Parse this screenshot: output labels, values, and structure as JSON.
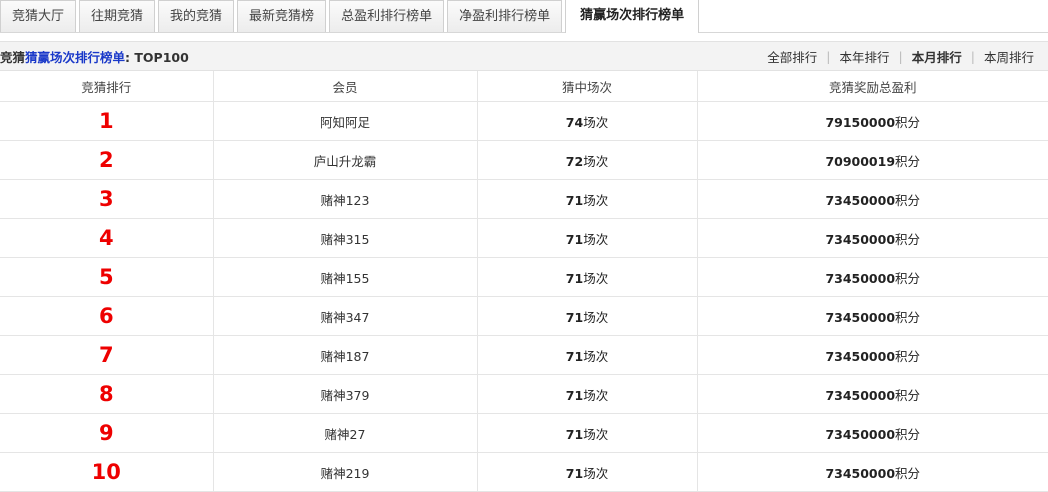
{
  "tabs": [
    {
      "label": "竞猜大厅",
      "active": false
    },
    {
      "label": "往期竞猜",
      "active": false
    },
    {
      "label": "我的竞猜",
      "active": false
    },
    {
      "label": "最新竞猜榜",
      "active": false
    },
    {
      "label": "总盈利排行榜单",
      "active": false
    },
    {
      "label": "净盈利排行榜单",
      "active": false
    },
    {
      "label": "猜赢场次排行榜单",
      "active": true
    }
  ],
  "header": {
    "prefix": "竞猜",
    "highlight": "猜赢场次排行榜单",
    "suffix": ": TOP100",
    "filters": [
      {
        "label": "全部排行",
        "current": false
      },
      {
        "label": "本年排行",
        "current": false
      },
      {
        "label": "本月排行",
        "current": true
      },
      {
        "label": "本周排行",
        "current": false
      }
    ]
  },
  "table": {
    "columns": [
      "竞猜排行",
      "会员",
      "猜中场次",
      "竞猜奖励总盈利"
    ],
    "rows": [
      {
        "rank": "1",
        "member": "阿知阿足",
        "count": "74",
        "count_unit": "场次",
        "score": "79150000",
        "score_unit": "积分"
      },
      {
        "rank": "2",
        "member": "庐山升龙霸",
        "count": "72",
        "count_unit": "场次",
        "score": "70900019",
        "score_unit": "积分"
      },
      {
        "rank": "3",
        "member": "赌神123",
        "count": "71",
        "count_unit": "场次",
        "score": "73450000",
        "score_unit": "积分"
      },
      {
        "rank": "4",
        "member": "赌神315",
        "count": "71",
        "count_unit": "场次",
        "score": "73450000",
        "score_unit": "积分"
      },
      {
        "rank": "5",
        "member": "赌神155",
        "count": "71",
        "count_unit": "场次",
        "score": "73450000",
        "score_unit": "积分"
      },
      {
        "rank": "6",
        "member": "赌神347",
        "count": "71",
        "count_unit": "场次",
        "score": "73450000",
        "score_unit": "积分"
      },
      {
        "rank": "7",
        "member": "赌神187",
        "count": "71",
        "count_unit": "场次",
        "score": "73450000",
        "score_unit": "积分"
      },
      {
        "rank": "8",
        "member": "赌神379",
        "count": "71",
        "count_unit": "场次",
        "score": "73450000",
        "score_unit": "积分"
      },
      {
        "rank": "9",
        "member": "赌神27",
        "count": "71",
        "count_unit": "场次",
        "score": "73450000",
        "score_unit": "积分"
      },
      {
        "rank": "10",
        "member": "赌神219",
        "count": "71",
        "count_unit": "场次",
        "score": "73450000",
        "score_unit": "积分"
      }
    ]
  }
}
